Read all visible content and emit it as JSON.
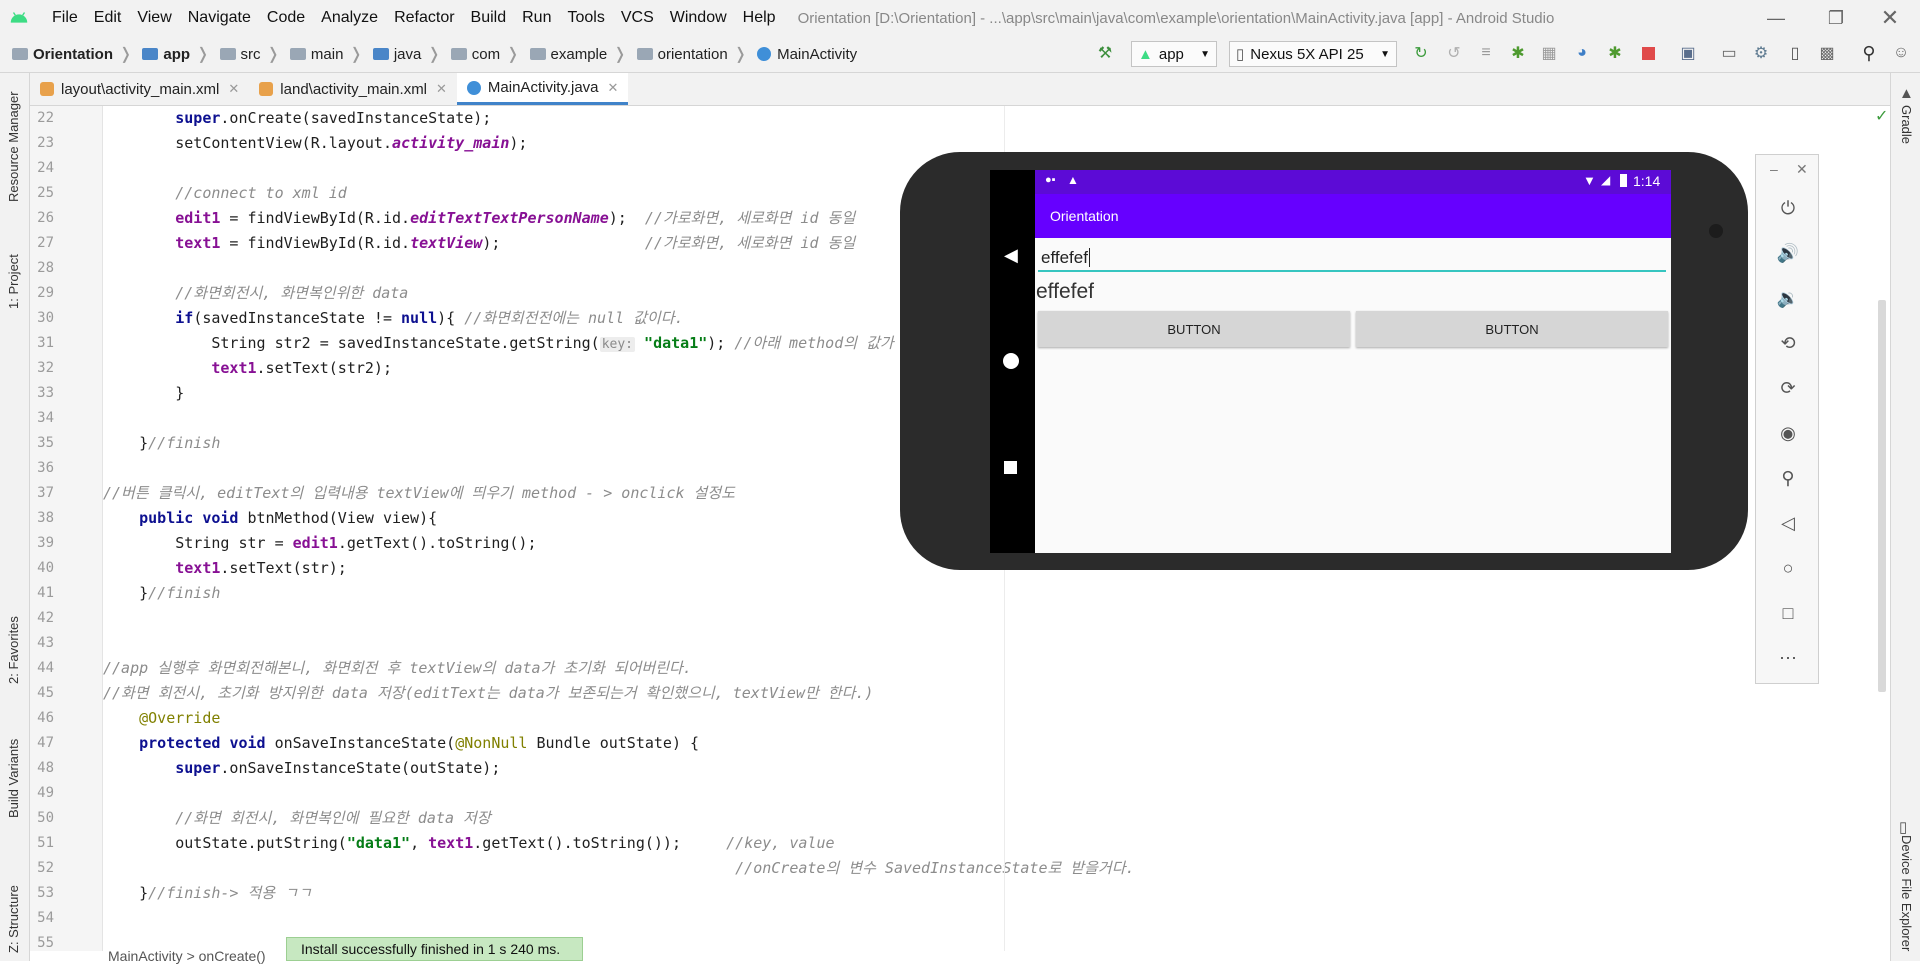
{
  "window": {
    "title": "Orientation [D:\\Orientation] - ...\\app\\src\\main\\java\\com\\example\\orientation\\MainActivity.java [app] - Android Studio"
  },
  "menu": [
    "File",
    "Edit",
    "View",
    "Navigate",
    "Code",
    "Analyze",
    "Refactor",
    "Build",
    "Run",
    "Tools",
    "VCS",
    "Window",
    "Help"
  ],
  "breadcrumb": [
    "Orientation",
    "app",
    "src",
    "main",
    "java",
    "com",
    "example",
    "orientation",
    "MainActivity"
  ],
  "toolbar": {
    "run_config": "app",
    "device": "Nexus 5X API 25"
  },
  "tabs": [
    {
      "label": "layout\\activity_main.xml",
      "active": false
    },
    {
      "label": "land\\activity_main.xml",
      "active": false
    },
    {
      "label": "MainActivity.java",
      "active": true
    }
  ],
  "side_tools": {
    "left": [
      "Resource Manager",
      "1: Project",
      "2: Favorites",
      "Build Variants",
      "Z: Structure"
    ],
    "right": [
      "Gradle",
      "Device File Explorer"
    ]
  },
  "code": {
    "line_numbers": [
      "22",
      "23",
      "24",
      "25",
      "26",
      "27",
      "28",
      "29",
      "30",
      "31",
      "32",
      "33",
      "34",
      "35",
      "36",
      "37",
      "38",
      "39",
      "40",
      "41",
      "42",
      "43",
      "44",
      "45",
      "46",
      "47",
      "48",
      "49",
      "50",
      "51",
      "52",
      "53",
      "54",
      "55"
    ],
    "lines": [
      "        super.onCreate(savedInstanceState);",
      "        setContentView(R.layout.activity_main);",
      "",
      "        //connect to xml id",
      "        edit1 = findViewById(R.id.editTextTextPersonName);  //가로화면, 세로화면 id 동일",
      "        text1 = findViewById(R.id.textView);                //가로화면, 세로화면 id 동일",
      "",
      "        //화면회전시, 화면복인위한 data",
      "        if(savedInstanceState != null){ //화면회전전에는 null 값이다.",
      "            String str2 = savedInstanceState.getString( key: \"data1\"); //아래 method의 값가",
      "            text1.setText(str2);",
      "        }",
      "",
      "    }//finish",
      "",
      "//버튼 클릭시, editText의 입력내용 textView에 띄우기 method - > onclick 설정도",
      "    public void btnMethod(View view){",
      "        String str = edit1.getText().toString();",
      "        text1.setText(str);",
      "    }//finish",
      "",
      "",
      "//app 실행후 화면회전해본니, 화면회전 후 textView의 data가 초기화 되어버린다.",
      "//화면 회전시, 초기화 방지위한 data 저장(editText는 data가 보존되는거 확인했으니, textView만 한다.)",
      "    @Override",
      "    protected void onSaveInstanceState(@NonNull Bundle outState) {",
      "        super.onSaveInstanceState(outState);",
      "",
      "        //화면 회전시, 화면복인에 필요한 data 저장",
      "        outState.putString(\"data1\", text1.getText().toString());     //key, value",
      "                                                                      //onCreate의 변수 SavedInstanceState로 받을거다.",
      "    }//finish-> 적용 ㄱㄱ",
      "",
      ""
    ]
  },
  "emulator": {
    "status_time": "1:14",
    "app_title": "Orientation",
    "edit_text": "effefef",
    "text_view": "effefef",
    "button1": "BUTTON",
    "button2": "BUTTON"
  },
  "toast": "Install successfully finished in 1 s 240 ms.",
  "editor_breadcrumb": "MainActivity  >  onCreate()"
}
